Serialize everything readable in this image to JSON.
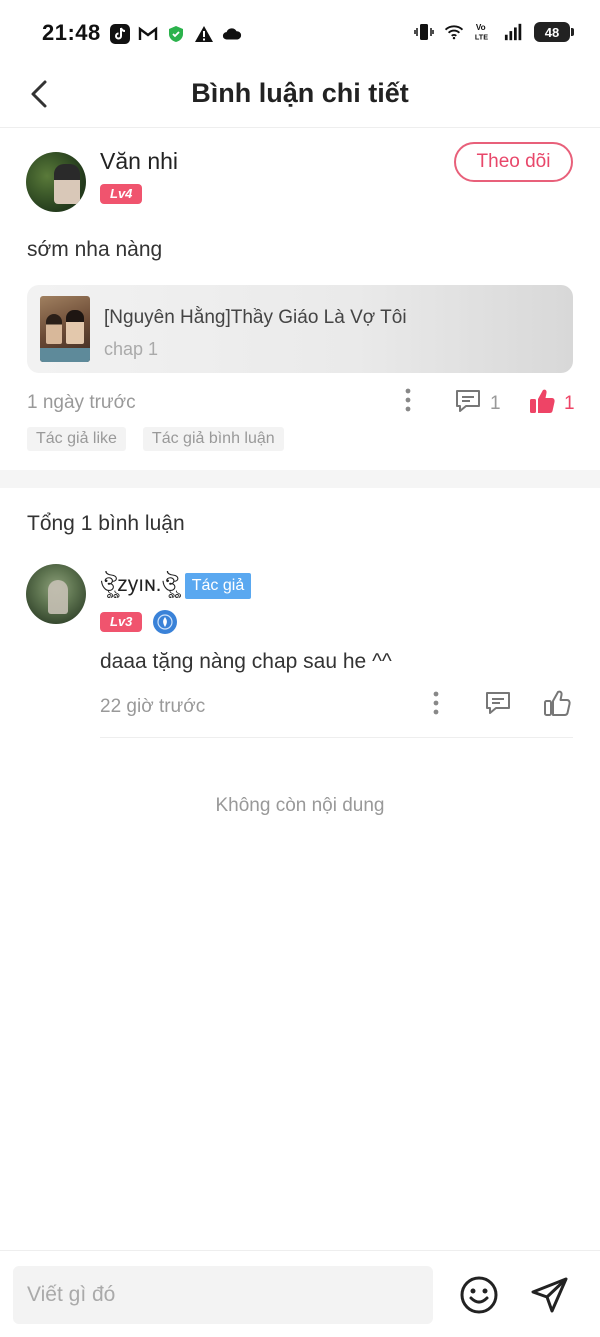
{
  "status_bar": {
    "time": "21:48",
    "battery": "48",
    "left_icons": [
      "tiktok-icon",
      "gmail-icon",
      "shield-icon",
      "warning-icon",
      "cloud-icon"
    ],
    "right_icons": [
      "vibrate-icon",
      "wifi-icon",
      "volte-icon",
      "signal-icon",
      "battery-icon"
    ]
  },
  "header": {
    "title": "Bình luận chi tiết"
  },
  "main_comment": {
    "author": "Văn nhi",
    "level": "Lv4",
    "follow_label": "Theo dõi",
    "text": "sớm nha nàng",
    "book": {
      "title": "[Nguyên Hằng]Thầy Giáo Là Vợ Tôi",
      "chapter": "chap 1"
    },
    "time": "1 ngày trước",
    "reply_count": "1",
    "like_count": "1",
    "tags": [
      "Tác giả like",
      "Tác giả bình luận"
    ]
  },
  "comments_section": {
    "total_label": "Tổng 1 bình luận",
    "replies": [
      {
        "author": "ঔৣzyıɴ.ঔৣ",
        "author_tag": "Tác giả",
        "level": "Lv3",
        "text": "daaa tặng nàng chap sau he ^^",
        "time": "22 giờ trước"
      }
    ],
    "no_more_label": "Không còn nội dung"
  },
  "bottom_bar": {
    "input_placeholder": "Viết gì đó"
  },
  "colors": {
    "accent": "#e8476a",
    "level_badge": "#f0546e",
    "author_tag": "#5aa8f0",
    "muted_text": "#999999"
  }
}
